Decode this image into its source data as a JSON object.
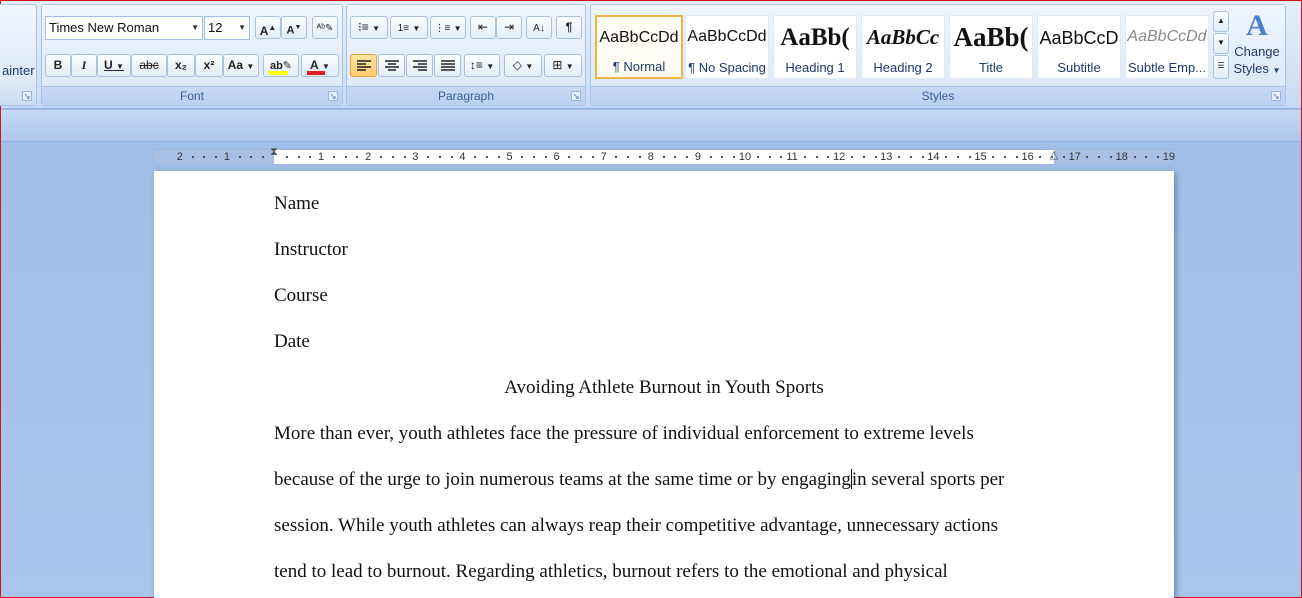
{
  "ribbon": {
    "clipboard": {
      "painter_label": "ainter"
    },
    "font": {
      "group_label": "Font",
      "font_name": "Times New Roman",
      "font_size": "12",
      "bold_label": "B",
      "italic_label": "I",
      "underline_label": "U",
      "strike_label": "abc",
      "subscript_label": "x₂",
      "superscript_label": "x²",
      "change_case_label": "Aa",
      "highlight_color": "#ffff00",
      "font_color": "#e02020"
    },
    "paragraph": {
      "group_label": "Paragraph",
      "active_alignment": "left"
    },
    "styles": {
      "group_label": "Styles",
      "gallery": [
        {
          "sample": "AaBbCcDd",
          "name": "¶ Normal"
        },
        {
          "sample": "AaBbCcDd",
          "name": "¶ No Spacing"
        },
        {
          "sample": "AaBb(",
          "name": "Heading 1"
        },
        {
          "sample": "AaBbCc",
          "name": "Heading 2"
        },
        {
          "sample": "AaBb(",
          "name": "Title"
        },
        {
          "sample": "AaBbCcD",
          "name": "Subtitle"
        },
        {
          "sample": "AaBbCcDd",
          "name": "Subtle Emp..."
        }
      ],
      "change_styles_label_1": "Change",
      "change_styles_label_2": "Styles"
    }
  },
  "ruler": {
    "left_numbers": [
      "2",
      "1"
    ],
    "right_numbers": [
      "1",
      "2",
      "3",
      "4",
      "5",
      "6",
      "7",
      "8",
      "9",
      "10",
      "11",
      "12",
      "13",
      "14",
      "15",
      "16",
      "17",
      "18",
      "19"
    ]
  },
  "document": {
    "lines": [
      "Name",
      "Instructor",
      "Course",
      "Date"
    ],
    "title": "Avoiding Athlete Burnout in Youth Sports",
    "paragraph_lines": [
      "More than ever, youth athletes face the pressure of individual enforcement to extreme levels",
      [
        "because of the urge to join numerous teams at the same time or by engaging",
        "in several sports per"
      ],
      "session. While youth athletes can always reap their competitive advantage, unnecessary actions",
      "tend to lead to burnout. Regarding athletics, burnout refers to the emotional and physical"
    ]
  }
}
